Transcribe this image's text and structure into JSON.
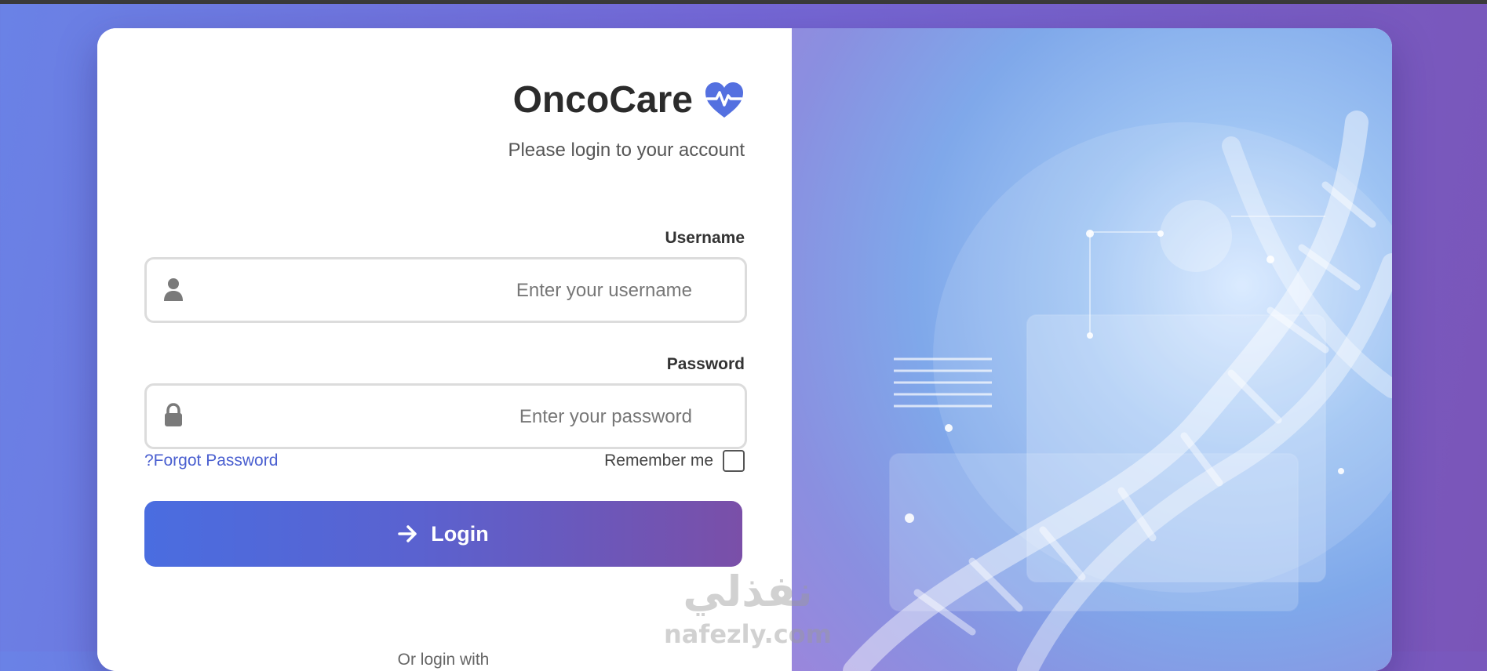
{
  "app": {
    "name": "OncoCare",
    "subtitle": "Please login to your account"
  },
  "form": {
    "username_label": "Username",
    "username_placeholder": "Enter your username",
    "password_label": "Password",
    "password_placeholder": "Enter your password",
    "forgot_link": "?Forgot Password",
    "remember_label": "Remember me",
    "remember_checked": false,
    "login_button": "Login",
    "alt_login": "Or login with"
  },
  "watermark": {
    "arabic": "نفذلي",
    "latin": "nafezly.com"
  },
  "icons": {
    "logo": "heart-pulse-icon",
    "username": "user-icon",
    "password": "lock-icon",
    "login": "arrow-right-icon"
  },
  "colors": {
    "accent": "#4a6de0",
    "accent_end": "#7a4fa8",
    "link": "#4a5fd0",
    "logo_heart": "#5470e0"
  }
}
